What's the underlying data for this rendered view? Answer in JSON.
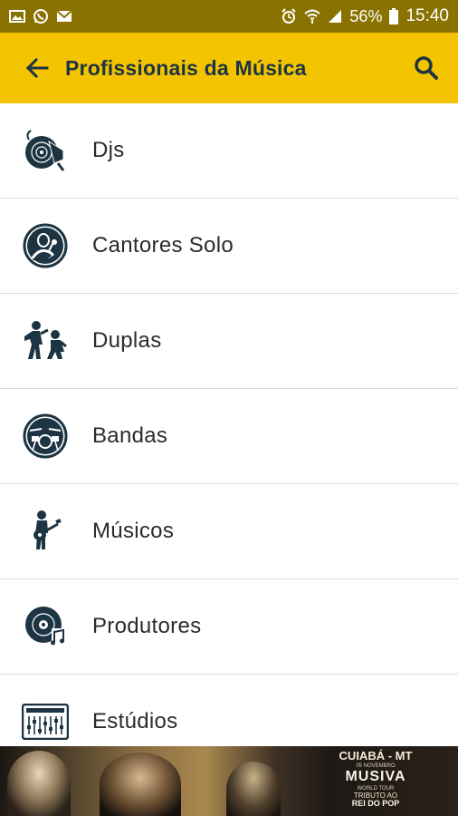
{
  "status_bar": {
    "battery_percent": "56%",
    "time": "15:40",
    "icons": [
      "image-icon",
      "whatsapp-icon",
      "email-icon",
      "alarm-icon",
      "wifi-icon",
      "signal-icon",
      "battery-icon"
    ]
  },
  "app_bar": {
    "title": "Profissionais da Música",
    "back_icon": "arrow-back-icon",
    "search_icon": "search-icon",
    "background": "#f4c400",
    "title_color": "#1d3543"
  },
  "categories": [
    {
      "label": "Djs",
      "icon": "dj-turntable-icon"
    },
    {
      "label": "Cantores Solo",
      "icon": "singer-icon"
    },
    {
      "label": "Duplas",
      "icon": "duo-icon"
    },
    {
      "label": "Bandas",
      "icon": "drum-kit-icon"
    },
    {
      "label": "Músicos",
      "icon": "guitarist-icon"
    },
    {
      "label": "Produtores",
      "icon": "record-producer-icon"
    },
    {
      "label": "Estúdios",
      "icon": "mixing-console-icon"
    }
  ],
  "icon_color": "#1d3543",
  "ad": {
    "city": "CUIABÁ - MT",
    "date": "05 NOVEMBRO",
    "brand": "MUSIVA",
    "subtitle": "WORLD TOUR",
    "tribute": "TRIBUTO AO",
    "rei": "REI DO POP"
  }
}
